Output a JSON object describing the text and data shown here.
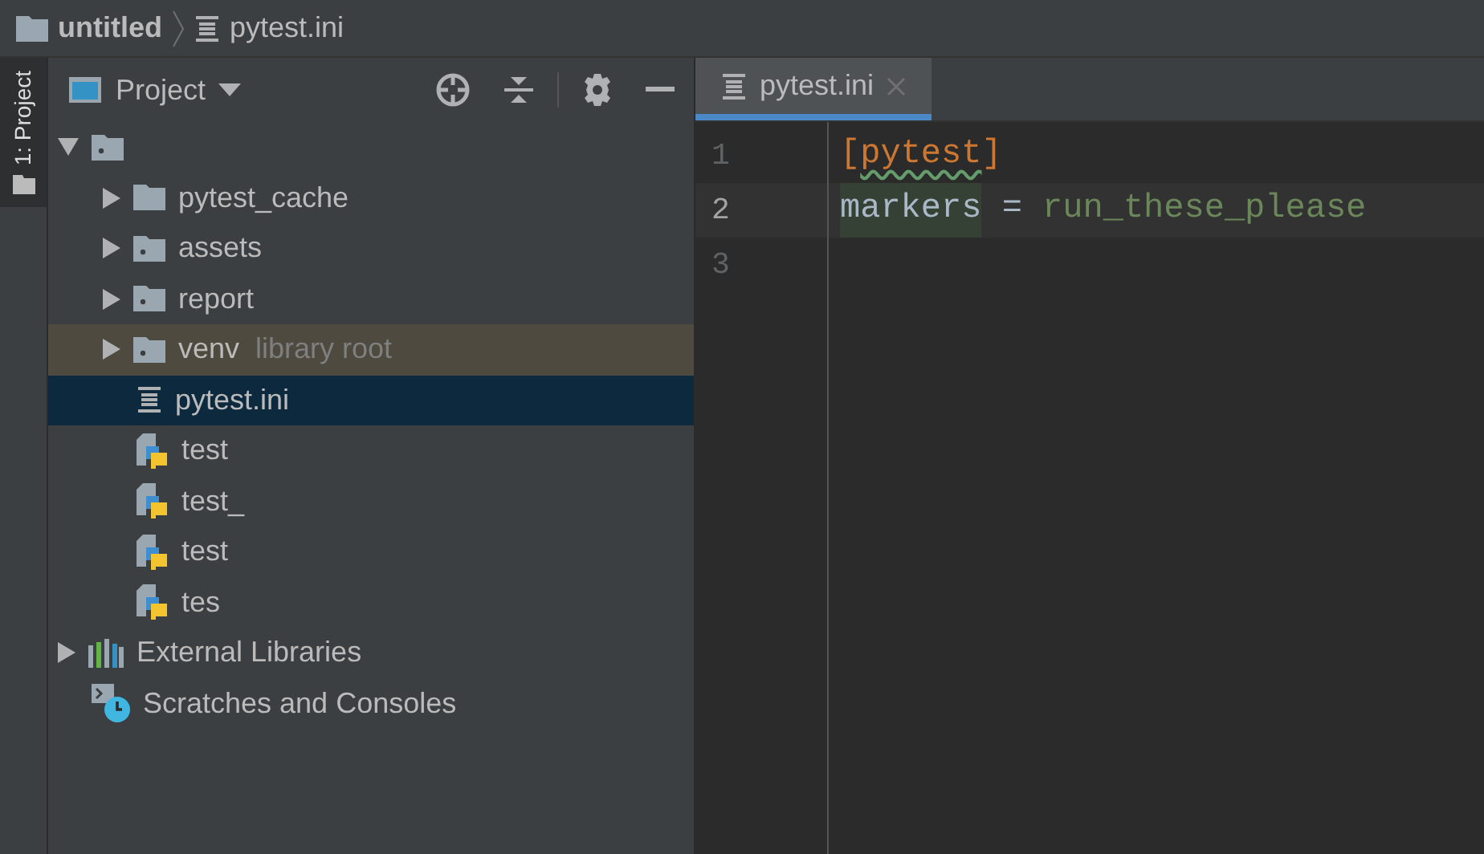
{
  "breadcrumb": [
    {
      "label": "untitled",
      "kind": "folder"
    },
    {
      "label": "pytest.ini",
      "kind": "ini"
    }
  ],
  "side_tabs": [
    {
      "label": "1: Project",
      "selected": true
    }
  ],
  "project_panel": {
    "title": "Project",
    "tree": [
      {
        "kind": "folder",
        "expanded": true,
        "selected": false,
        "children": [
          {
            "kind": "excluded",
            "label": "pytest_cache",
            "expanded": false,
            "selected": false
          },
          {
            "kind": "folder",
            "label": "assets",
            "expanded": false,
            "selected": false
          },
          {
            "kind": "folder",
            "label": "report",
            "expanded": false,
            "selected": false
          },
          {
            "kind": "folder",
            "label": "venv",
            "hint": "library root",
            "expanded": false,
            "selected": false
          },
          {
            "kind": "ini",
            "label": "pytest.ini",
            "selected": true
          },
          {
            "kind": "python",
            "label": "test",
            "selected": false
          },
          {
            "kind": "python",
            "label": "test_",
            "selected": false
          },
          {
            "kind": "python",
            "label": "test",
            "selected": false
          },
          {
            "kind": "python",
            "label": "tes",
            "selected": false
          }
        ]
      },
      {
        "kind": "libraries",
        "label": "External Libraries",
        "expanded": false,
        "selected": false
      },
      {
        "kind": "scratches",
        "label": "Scratches and Consoles",
        "selected": false
      }
    ]
  },
  "editor": {
    "tabs": [
      {
        "label": "pytest.ini",
        "selected": true
      }
    ],
    "lines": [
      {
        "number": "1",
        "current": false,
        "tokens": [
          {
            "text": "[",
            "kind": "section"
          },
          {
            "text": "pytest",
            "kind": "section",
            "typo": true
          },
          {
            "text": "]",
            "kind": "section"
          }
        ]
      },
      {
        "number": "2",
        "current": true,
        "tokens": [
          {
            "text": "markers",
            "kind": "key",
            "highlighted": true
          },
          {
            "text": " = ",
            "kind": "op"
          },
          {
            "text": "run_these_please",
            "kind": "value"
          }
        ]
      },
      {
        "number": "3",
        "current": false
      }
    ]
  }
}
